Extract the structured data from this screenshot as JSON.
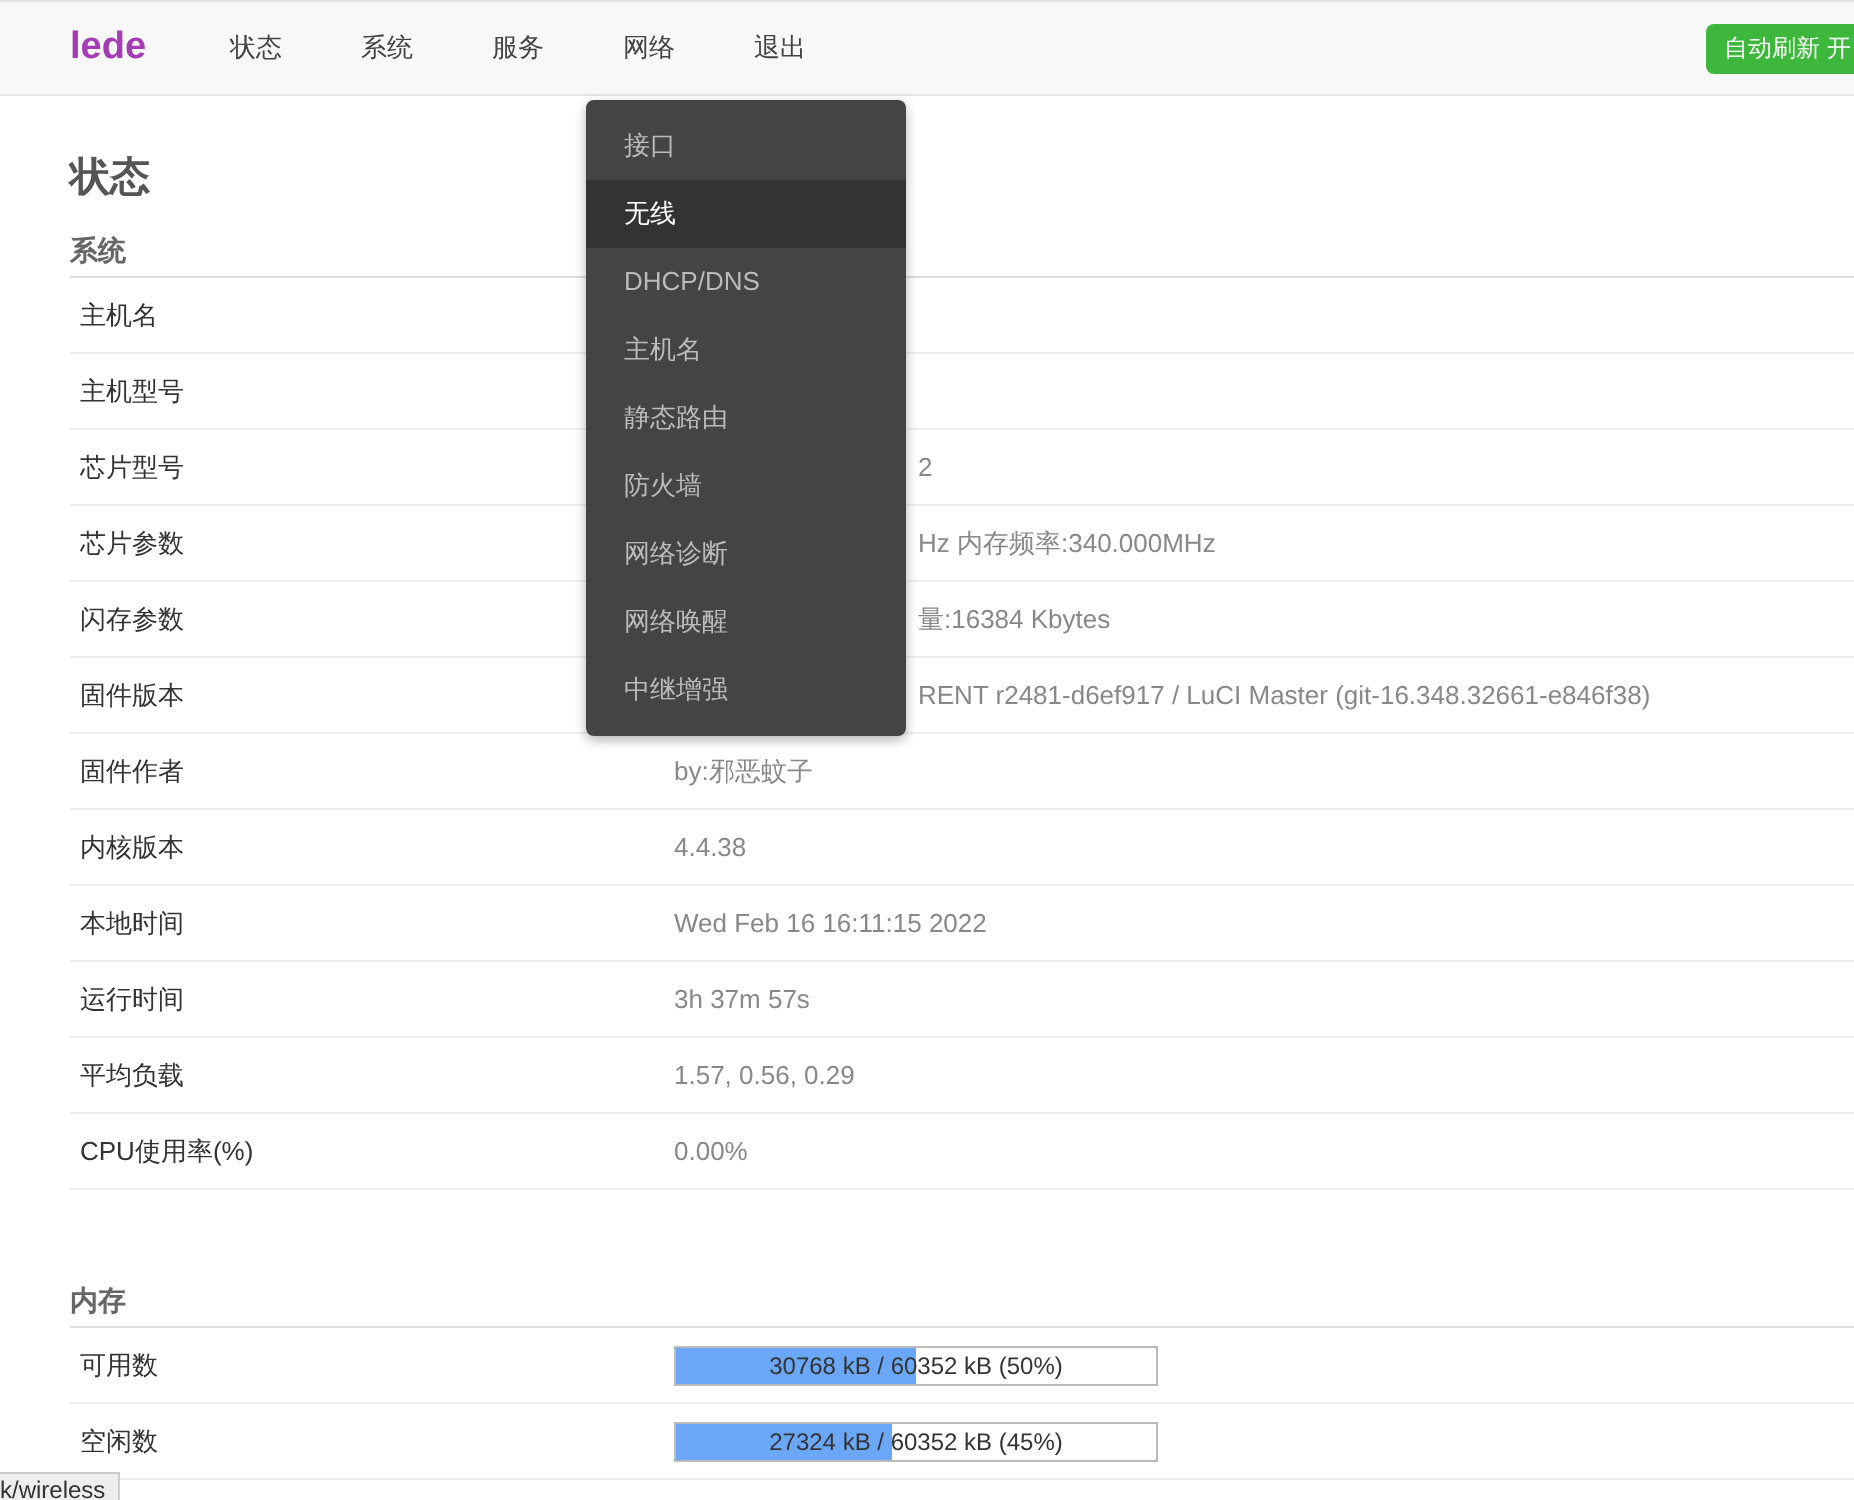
{
  "header": {
    "logo": "lede",
    "nav": [
      "状态",
      "系统",
      "服务",
      "网络",
      "退出"
    ],
    "refresh_button": "自动刷新 开"
  },
  "dropdown": {
    "items": [
      {
        "label": "接口",
        "selected": false
      },
      {
        "label": "无线",
        "selected": true
      },
      {
        "label": "DHCP/DNS",
        "selected": false
      },
      {
        "label": "主机名",
        "selected": false
      },
      {
        "label": "静态路由",
        "selected": false
      },
      {
        "label": "防火墙",
        "selected": false
      },
      {
        "label": "网络诊断",
        "selected": false
      },
      {
        "label": "网络唤醒",
        "selected": false
      },
      {
        "label": "中继增强",
        "selected": false
      }
    ]
  },
  "page_title": "状态",
  "system": {
    "title": "系统",
    "rows": [
      {
        "label": "主机名"
      },
      {
        "label": "主机型号"
      },
      {
        "label": "芯片型号",
        "value": "2",
        "kind": "partial"
      },
      {
        "label": "芯片参数",
        "value": "Hz 内存频率:340.000MHz",
        "kind": "partial"
      },
      {
        "label": "闪存参数",
        "value": "量:16384 Kbytes",
        "kind": "partial"
      },
      {
        "label": "固件版本",
        "value": "RENT r2481-d6ef917 / LuCI Master (git-16.348.32661-e846f38)",
        "kind": "partial"
      },
      {
        "label": "固件作者",
        "value": "by:邪恶蚊子",
        "kind": "full"
      },
      {
        "label": "内核版本",
        "value": "4.4.38",
        "kind": "full"
      },
      {
        "label": "本地时间",
        "value": "Wed Feb 16 16:11:15 2022",
        "kind": "full"
      },
      {
        "label": "运行时间",
        "value": "3h 37m 57s",
        "kind": "full"
      },
      {
        "label": "平均负载",
        "value": "1.57, 0.56, 0.29",
        "kind": "full"
      },
      {
        "label": "CPU使用率(%)",
        "value": "0.00%",
        "kind": "full"
      }
    ]
  },
  "memory": {
    "title": "内存",
    "rows": [
      {
        "label": "可用数",
        "reading": "30768 kB / 60352 kB (50%)",
        "level": 0.5
      },
      {
        "label": "空闲数",
        "reading": "27324 kB / 60352 kB (45%)",
        "level": 0.45
      }
    ]
  },
  "status_bar": "k/wireless"
}
